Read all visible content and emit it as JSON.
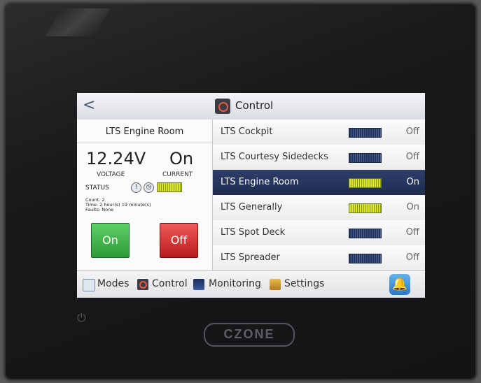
{
  "window": {
    "title": "Control",
    "back_icon": "chevron-left-icon",
    "title_icon": "control-icon"
  },
  "panel": {
    "title": "LTS Engine Room",
    "voltage_value": "12.24V",
    "voltage_label": "VOLTAGE",
    "current_value": "On",
    "current_label": "CURRENT",
    "status_label": "STATUS",
    "details": [
      "Count: 2",
      "Time: 2 hour(s) 19 minute(s)",
      "Faults:    None"
    ],
    "on_label": "On",
    "off_label": "Off"
  },
  "circuits": [
    {
      "label": "LTS Cockpit",
      "state": "Off",
      "selected": false,
      "meter": "off"
    },
    {
      "label": "LTS Courtesy Sidedecks",
      "state": "Off",
      "selected": false,
      "meter": "off"
    },
    {
      "label": "LTS Engine Room",
      "state": "On",
      "selected": true,
      "meter": "on"
    },
    {
      "label": "LTS Generally",
      "state": "On",
      "selected": false,
      "meter": "on"
    },
    {
      "label": "LTS Spot Deck",
      "state": "Off",
      "selected": false,
      "meter": "off"
    },
    {
      "label": "LTS Spreader",
      "state": "Off",
      "selected": false,
      "meter": "off"
    }
  ],
  "nav": {
    "modes": "Modes",
    "control": "Control",
    "monitoring": "Monitoring",
    "settings": "Settings",
    "alarm_icon": "bell-icon"
  },
  "device": {
    "logo": "CZONE",
    "power_icon": "power-icon"
  },
  "colors": {
    "on_button": "#2c9a35",
    "off_button": "#b81b1b",
    "selected_row": "#1f2c50",
    "meter_on": "#dde52a",
    "meter_off": "#22345c"
  }
}
